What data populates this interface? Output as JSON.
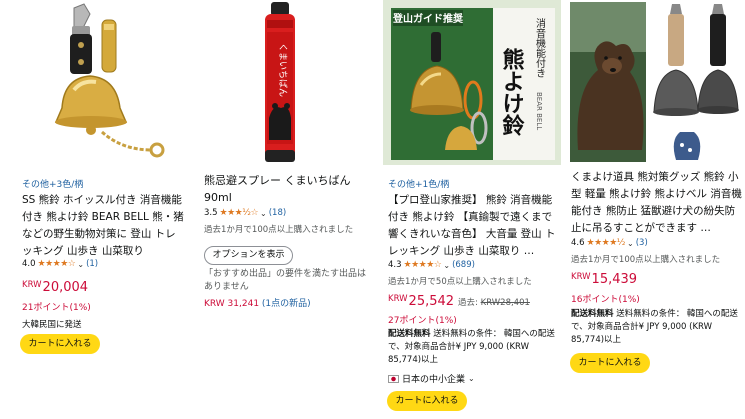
{
  "products": [
    {
      "variant": "その他+3色/柄",
      "title": "SS 熊鈴 ホイッスル付き 消音機能付き 熊よけ鈴 BEAR BELL 熊・猪などの野生動物対策に 登山 トレッキング 山歩き 山菜取り",
      "rating": "4.0",
      "stars": "★★★★☆",
      "review_count": "(1)",
      "currency": "KRW",
      "price": "20,004",
      "points": "21ポイント(1%)",
      "shipping_note": "大韓民国に発送",
      "cart_label": "カートに入れる"
    },
    {
      "title": "熊忌避スプレー くまいちばん 90ml",
      "rating": "3.5",
      "stars": "★★★½☆",
      "review_count": "(18)",
      "bought": "過去1か月で100点以上購入されました",
      "options_label": "オプションを表示",
      "note": "「おすすめ出品」の要件を満たす出品はありません",
      "used_price": "KRW 31,241",
      "used_link": "(1点の新品)",
      "image_text": "くまいちばん"
    },
    {
      "variant": "その他+1色/柄",
      "title": "【プロ登山家推奨】 熊鈴 消音機能付き 熊よけ鈴 【真鍮製で遠くまで響くきれいな音色】 大音量 登山 トレッキング 山歩き 山菜取り …",
      "rating": "4.3",
      "stars": "★★★★☆",
      "review_count": "(689)",
      "bought": "過去1か月で50点以上購入されました",
      "currency": "KRW",
      "price": "25,542",
      "orig_label": "過去:",
      "orig_price": "KRW28,401",
      "points": "27ポイント(1%)",
      "ship_bold": "配送料無料",
      "ship_text": " 送料無料の条件： 韓国への配送で、対象商品合計¥ JPY 9,000 (KRW 85,774)以上",
      "seller_badge": "日本の中小企業",
      "cart_label": "カートに入れる",
      "image_banner": "登山ガイド推奨",
      "image_title": "熊よけ鈴",
      "image_sub": "消音機能付き",
      "image_brand": "BEAR BELL"
    },
    {
      "title": "くまよけ道具 熊対策グッズ 熊鈴 小型 軽量 熊よけ鈴 熊よけベル 消音機能付き 熊防止 猛獣避け犬の紛失防止に吊るすことができます …",
      "rating": "4.6",
      "stars": "★★★★½",
      "review_count": "(3)",
      "bought": "過去1か月で100点以上購入されました",
      "currency": "KRW",
      "price": "15,439",
      "points": "16ポイント(1%)",
      "ship_bold": "配送料無料",
      "ship_text": " 送料無料の条件： 韓国への配送で、対象商品合計¥ JPY 9,000 (KRW 85,774)以上",
      "cart_label": "カートに入れる"
    }
  ],
  "colors": {
    "price": "#cc0c39",
    "link": "#2162a1",
    "star": "#de7921",
    "cart_button": "#ffd814"
  }
}
